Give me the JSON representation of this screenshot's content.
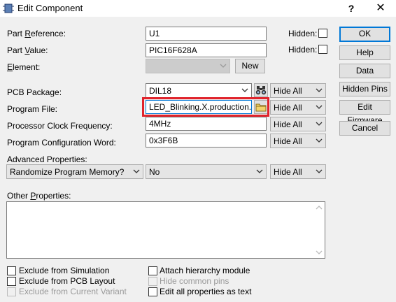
{
  "title": "Edit Component",
  "titlebar": {
    "help": "?",
    "close": "✕"
  },
  "fields": {
    "part_reference": {
      "label_pre": "Part ",
      "label_u": "R",
      "label_post": "eference:",
      "value": "U1",
      "hidden_label": "Hidden:"
    },
    "part_value": {
      "label_pre": "Part ",
      "label_u": "V",
      "label_post": "alue:",
      "value": "PIC16F628A",
      "hidden_label": "Hidden:"
    },
    "element": {
      "label_u": "E",
      "label_post": "lement:",
      "value": "",
      "new_button": "New"
    },
    "pcb_package": {
      "label": "PCB Package:",
      "value": "DIL18",
      "visibility": "Hide All"
    },
    "program_file": {
      "label": "Program File:",
      "value": "LED_Blinking.X.production.hex",
      "visibility": "Hide All"
    },
    "clock_frequency": {
      "label": "Processor Clock Frequency:",
      "value": "4MHz",
      "visibility": "Hide All"
    },
    "config_word": {
      "label": "Program Configuration Word:",
      "value": "0x3F6B",
      "visibility": "Hide All"
    }
  },
  "advanced": {
    "label": "Advanced Properties:",
    "property": "Randomize Program Memory?",
    "value": "No",
    "visibility": "Hide All"
  },
  "other": {
    "label_pre": "Other ",
    "label_u": "P",
    "label_post": "roperties:"
  },
  "buttons": {
    "ok": "OK",
    "help": "Help",
    "data": "Data",
    "hidden_pins": "Hidden Pins",
    "edit_firmware": "Edit Firmware",
    "cancel": "Cancel"
  },
  "checkboxes": {
    "exclude_simulation": "Exclude from Simulation",
    "exclude_pcb": "Exclude from PCB Layout",
    "exclude_variant": "Exclude from Current Variant",
    "attach_hierarchy": "Attach hierarchy module",
    "hide_common_pins": "Hide common pins",
    "edit_all_as_text": "Edit all properties as text"
  },
  "colors": {
    "highlight": "#e0232b",
    "focus": "#0078d7",
    "dialog_bg": "#f0f0f0"
  },
  "icons": {
    "app": "component-icon",
    "package_browse": "binoculars-icon",
    "file_browse": "folder-icon"
  }
}
